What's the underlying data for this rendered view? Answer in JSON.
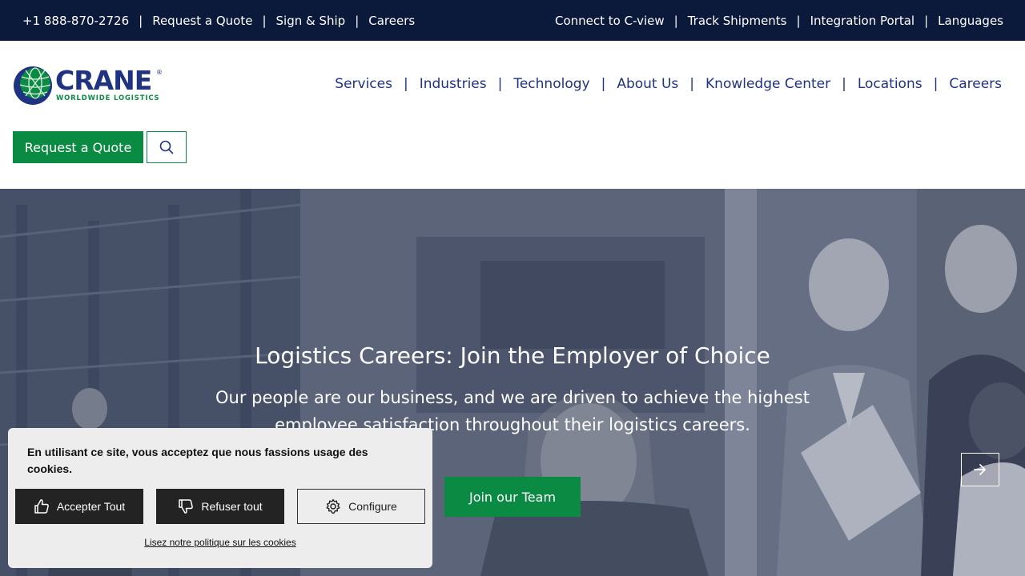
{
  "topbar": {
    "left": [
      "+1 888-870-2726",
      "Request a Quote",
      "Sign & Ship",
      "Careers"
    ],
    "right": [
      "Connect to C-view",
      "Track Shipments",
      "Integration Portal",
      "Languages"
    ],
    "separator": "|"
  },
  "logo": {
    "wordmark": "CRANE",
    "registered": "®",
    "tagline": "WORLDWIDE LOGISTICS"
  },
  "nav": {
    "items": [
      "Services",
      "Industries",
      "Technology",
      "About Us",
      "Knowledge Center",
      "Locations",
      "Careers"
    ],
    "separator": "|"
  },
  "header": {
    "quote_button": "Request a Quote",
    "search_icon": "search-icon"
  },
  "hero": {
    "title": "Logistics Careers: Join the Employer of Choice",
    "subtitle": "Our people are our business, and we are driven to achieve the highest employee satisfaction throughout their logistics careers.",
    "cta": "Join our Team",
    "next_icon": "arrow-right-icon"
  },
  "cookie": {
    "message": "En utilisant ce site, vous acceptez que nous fassions usage des cookies.",
    "accept": "Accepter Tout",
    "refuse": "Refuser tout",
    "configure": "Configure",
    "policy_link": "Lisez notre politique sur les cookies",
    "accept_icon": "thumbs-up-icon",
    "refuse_icon": "thumbs-down-icon",
    "configure_icon": "gear-icon"
  },
  "colors": {
    "topbar_bg": "#0b1a3a",
    "brand_blue": "#1f3380",
    "brand_green": "#0b8a43"
  }
}
